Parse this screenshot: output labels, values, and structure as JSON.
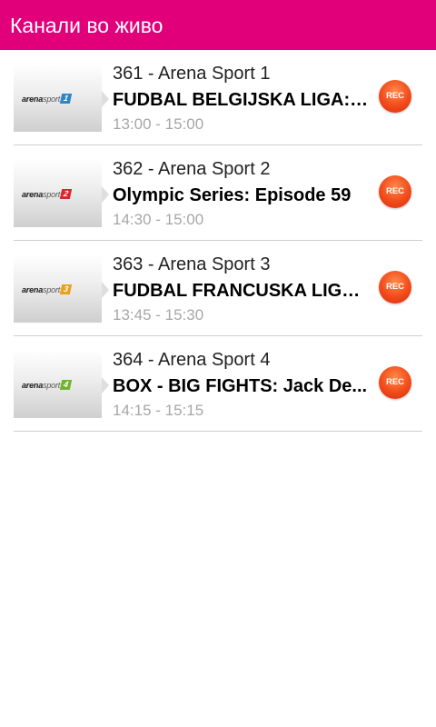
{
  "appbar": {
    "title": "Канали во живо",
    "color": "#e2007a"
  },
  "channels": [
    {
      "title": "361 - Arena Sport 1",
      "program": "FUDBAL BELGIJSKA LIGA: S...",
      "time": "13:00 - 15:00",
      "logo": {
        "word_bold": "arena",
        "word_light": "sport",
        "number": "1",
        "color": "#2a86c8"
      },
      "rec_label": "REC"
    },
    {
      "title": "362 - Arena Sport 2",
      "program": "Olympic Series: Episode 59",
      "time": "14:30 - 15:00",
      "logo": {
        "word_bold": "arena",
        "word_light": "sport",
        "number": "2",
        "color": "#d8262b"
      },
      "rec_label": "REC"
    },
    {
      "title": "363 - Arena Sport 3",
      "program": "FUDBAL FRANCUSKA LIGA:...",
      "time": "13:45 - 15:30",
      "logo": {
        "word_bold": "arena",
        "word_light": "sport",
        "number": "3",
        "color": "#e8a21a"
      },
      "rec_label": "REC"
    },
    {
      "title": "364 - Arena Sport 4",
      "program": "BOX - BIG FIGHTS: Jack De...",
      "time": "14:15 - 15:15",
      "logo": {
        "word_bold": "arena",
        "word_light": "sport",
        "number": "4",
        "color": "#6fb52c"
      },
      "rec_label": "REC"
    }
  ]
}
